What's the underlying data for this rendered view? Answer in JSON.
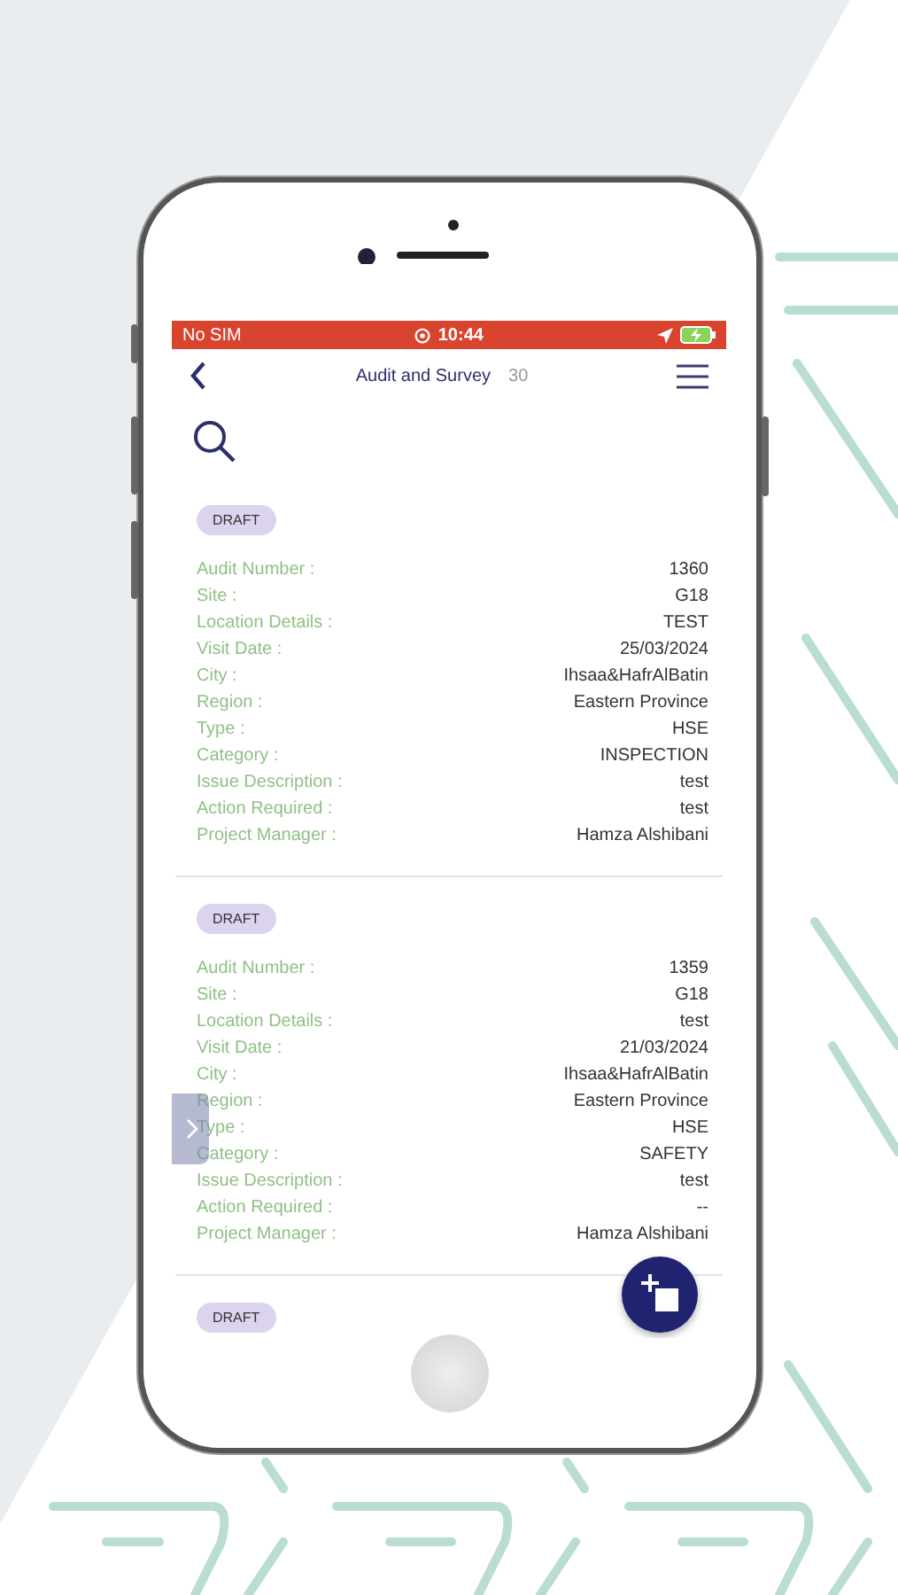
{
  "status_bar": {
    "carrier": "No SIM",
    "time": "10:44",
    "charging": true
  },
  "header": {
    "title": "Audit and Survey",
    "count": "30"
  },
  "records": [
    {
      "status": "DRAFT",
      "fields": [
        {
          "label": "Audit Number :",
          "value": "1360"
        },
        {
          "label": "Site :",
          "value": "G18"
        },
        {
          "label": "Location Details :",
          "value": "TEST"
        },
        {
          "label": "Visit Date :",
          "value": "25/03/2024"
        },
        {
          "label": "City :",
          "value": "Ihsaa&HafrAlBatin"
        },
        {
          "label": "Region :",
          "value": "Eastern Province"
        },
        {
          "label": "Type :",
          "value": "HSE"
        },
        {
          "label": "Category :",
          "value": "INSPECTION"
        },
        {
          "label": "Issue Description :",
          "value": "test"
        },
        {
          "label": "Action Required :",
          "value": "test"
        },
        {
          "label": "Project Manager :",
          "value": "Hamza Alshibani"
        }
      ]
    },
    {
      "status": "DRAFT",
      "fields": [
        {
          "label": "Audit Number :",
          "value": "1359"
        },
        {
          "label": "Site :",
          "value": "G18"
        },
        {
          "label": "Location Details :",
          "value": "test"
        },
        {
          "label": "Visit Date :",
          "value": "21/03/2024"
        },
        {
          "label": "City :",
          "value": "Ihsaa&HafrAlBatin"
        },
        {
          "label": "Region :",
          "value": "Eastern Province"
        },
        {
          "label": "Type :",
          "value": "HSE"
        },
        {
          "label": "Category :",
          "value": "SAFETY"
        },
        {
          "label": "Issue Description :",
          "value": "test"
        },
        {
          "label": "Action Required :",
          "value": "--"
        },
        {
          "label": "Project Manager :",
          "value": "Hamza Alshibani"
        }
      ]
    },
    {
      "status": "DRAFT"
    }
  ]
}
